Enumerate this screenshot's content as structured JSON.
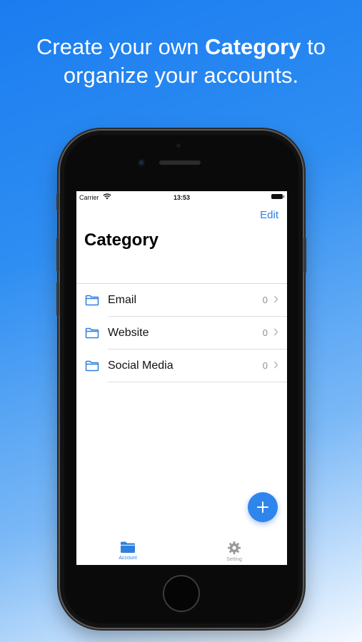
{
  "headline": {
    "line1_pre": "Create your own ",
    "line1_bold": "Category",
    "line1_post": " to",
    "line2": "organize your accounts."
  },
  "status_bar": {
    "carrier": "Carrier",
    "time": "13:53"
  },
  "nav": {
    "edit_label": "Edit",
    "title": "Category"
  },
  "categories": [
    {
      "label": "Email",
      "count": "0"
    },
    {
      "label": "Website",
      "count": "0"
    },
    {
      "label": "Social Media",
      "count": "0"
    }
  ],
  "tabbar": {
    "account_label": "Account",
    "setting_label": "Setting"
  },
  "colors": {
    "accent": "#2f7fe0",
    "background_top": "#1a7cf0",
    "fab": "#2f85ec"
  },
  "icons": {
    "row_icon": "folder-icon",
    "fab_icon": "plus-icon",
    "account_tab_icon": "folder-fill-icon",
    "setting_tab_icon": "gear-icon"
  }
}
